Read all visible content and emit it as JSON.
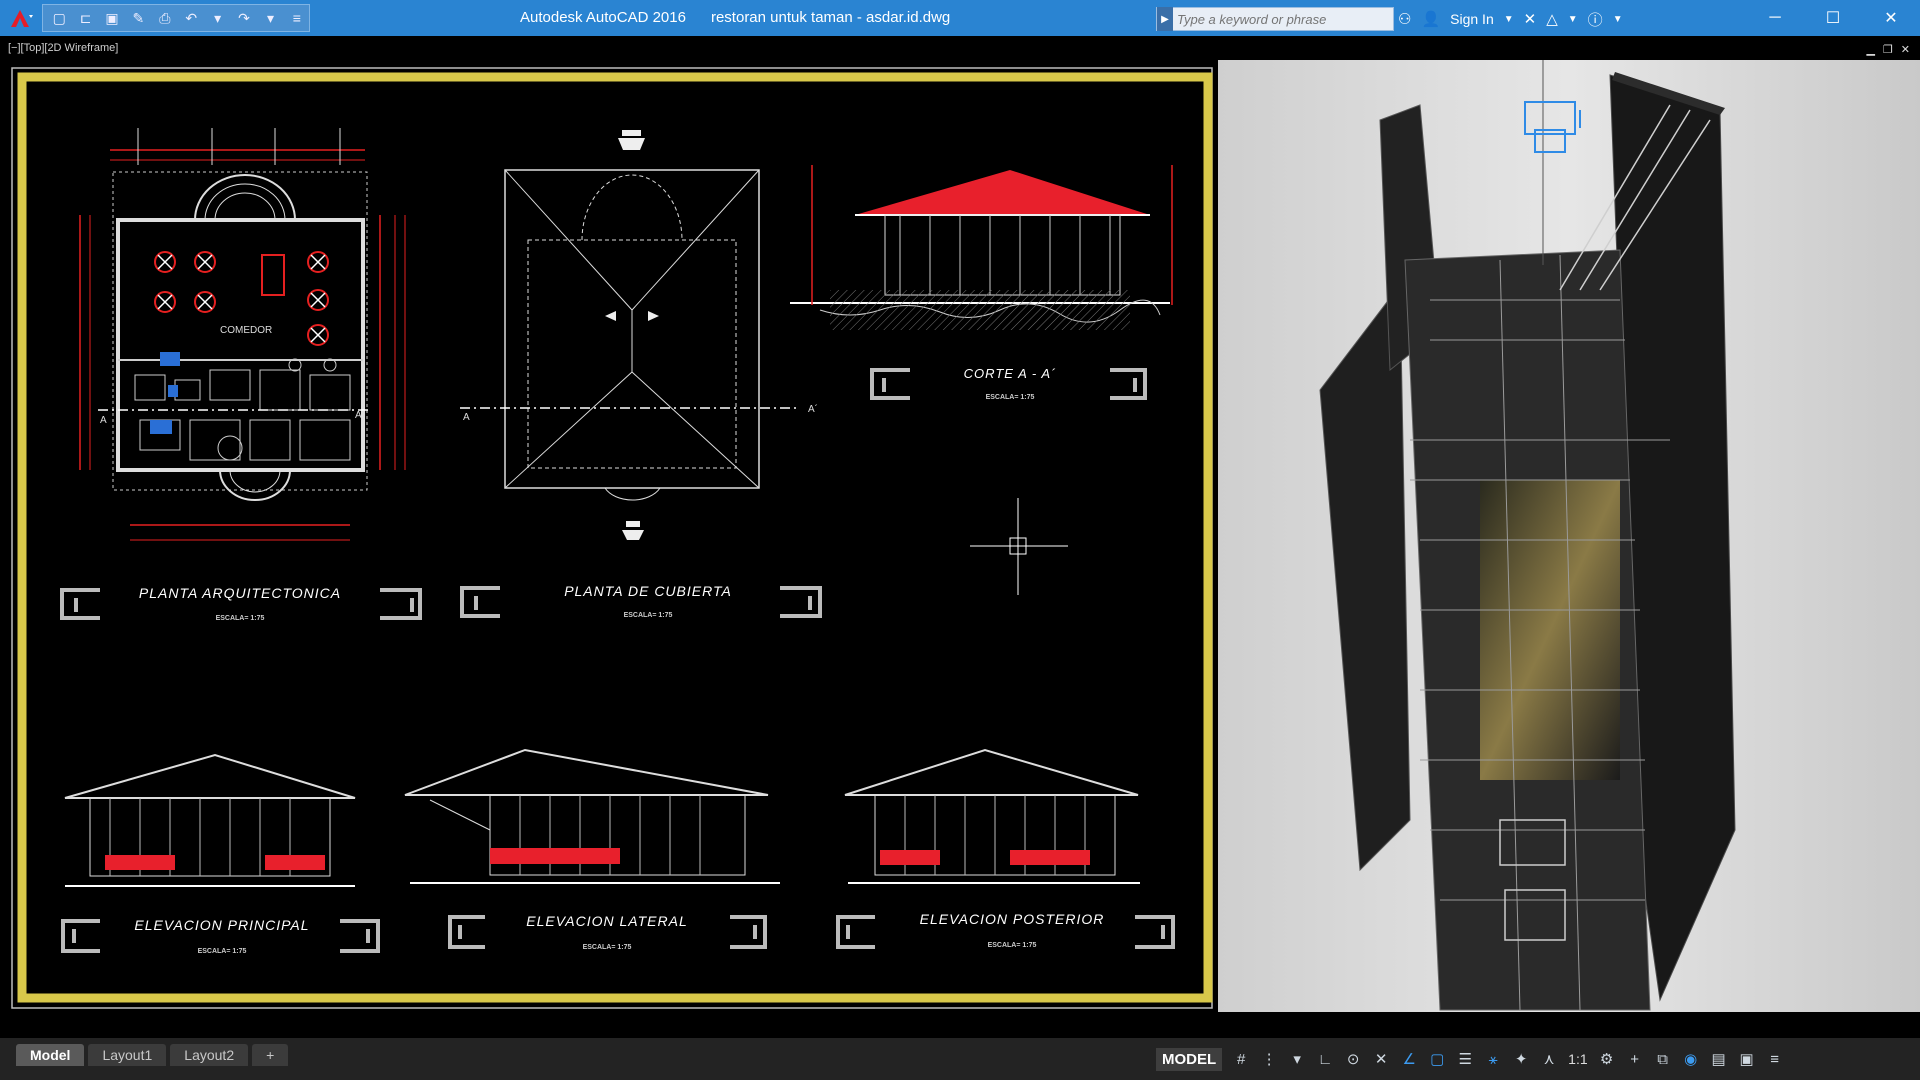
{
  "window": {
    "title": "Autodesk AutoCAD 2016",
    "filename": "restoran untuk taman - asdar.id.dwg"
  },
  "search": {
    "placeholder": "Type a keyword or phrase"
  },
  "account": {
    "sign_in": "Sign In"
  },
  "viewport": {
    "label": "[−][Top][2D Wireframe]"
  },
  "drawing": {
    "comedor": "COMEDOR",
    "section_marker_a": "A",
    "section_marker_a_prime": "A´",
    "scale_text": "ESCALA= 1:75",
    "titles": {
      "planta_arq": "PLANTA ARQUITECTONICA",
      "planta_cub": "PLANTA DE CUBIERTA",
      "corte": "CORTE A - A´",
      "elev_principal": "ELEVACION PRINCIPAL",
      "elev_lateral": "ELEVACION LATERAL",
      "elev_posterior": "ELEVACION POSTERIOR"
    }
  },
  "layout_tabs": [
    "Model",
    "Layout1",
    "Layout2"
  ],
  "status": {
    "model": "MODEL",
    "scale": "1:1"
  },
  "colors": {
    "titlebar": "#2a84d2",
    "frame_yellow": "#d8c84a",
    "roof_red": "#e8202c"
  }
}
